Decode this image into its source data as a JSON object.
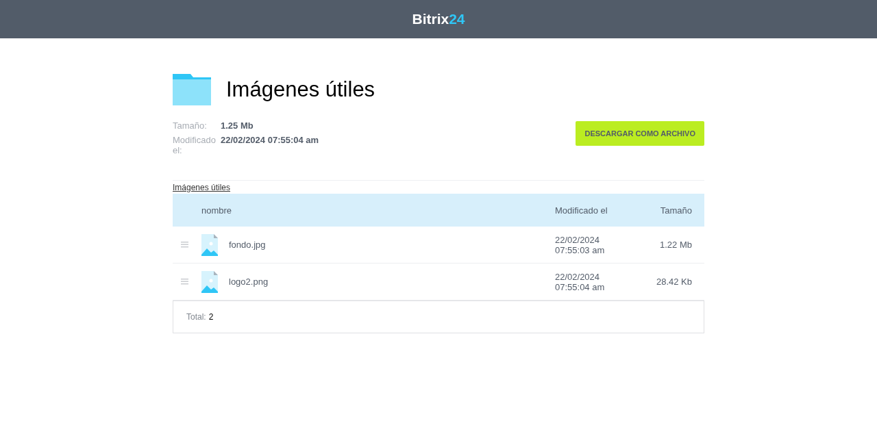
{
  "header": {
    "logo_text": "Bitrix",
    "logo_number": "24"
  },
  "folder": {
    "title": "Imágenes útiles",
    "details": [
      {
        "label": "Tamaño:",
        "value": "1.25 Mb"
      },
      {
        "label": "Modificado el:",
        "value": "22/02/2024 07:55:04 am"
      }
    ],
    "download_button": "DESCARGAR COMO ARCHIVO"
  },
  "breadcrumb": "Imágenes útiles",
  "table": {
    "columns": [
      "nombre",
      "Modificado el",
      "Tamaño"
    ],
    "rows": [
      {
        "name": "fondo.jpg",
        "modified_date": "22/02/2024",
        "modified_time": "07:55:03 am",
        "size": "1.22 Mb"
      },
      {
        "name": "logo2.png",
        "modified_date": "22/02/2024",
        "modified_time": "07:55:04 am",
        "size": "28.42 Kb"
      }
    ],
    "total_label": "Total:",
    "total_value": "2"
  }
}
